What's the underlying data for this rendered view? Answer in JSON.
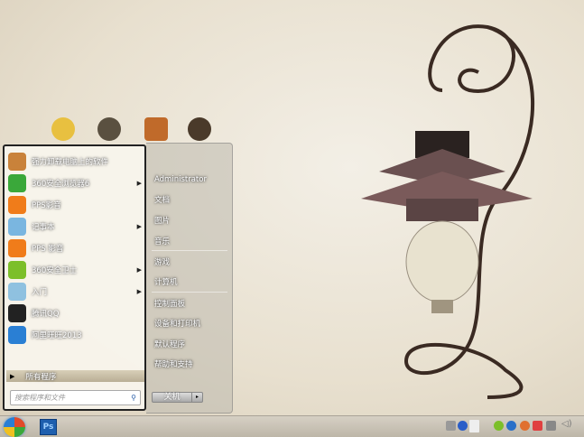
{
  "start_menu": {
    "programs": [
      {
        "label": "强力卸载电脑上的软件",
        "icon": "uninstall-icon",
        "color": "#c9823a",
        "submenu": false
      },
      {
        "label": "360安全浏览器6",
        "icon": "360-browser-icon",
        "color": "#3aa83a",
        "submenu": true
      },
      {
        "label": "PPS影音",
        "icon": "pps-icon",
        "color": "#f07c1a",
        "submenu": false
      },
      {
        "label": "记事本",
        "icon": "notepad-icon",
        "color": "#7ab6e0",
        "submenu": true
      },
      {
        "label": "PPS 影音",
        "icon": "pps-icon",
        "color": "#f07c1a",
        "submenu": false
      },
      {
        "label": "360安全卫士",
        "icon": "360-safe-icon",
        "color": "#7cbf2a",
        "submenu": true
      },
      {
        "label": "入门",
        "icon": "getting-started-icon",
        "color": "#8fc1e0",
        "submenu": true
      },
      {
        "label": "腾讯QQ",
        "icon": "qq-penguin-icon",
        "color": "#222",
        "submenu": false
      },
      {
        "label": "阿里旺旺2013",
        "icon": "aliwangwang-icon",
        "color": "#2a7fd4",
        "submenu": false
      }
    ],
    "all_programs": "所有程序",
    "search_placeholder": "搜索程序和文件",
    "right": [
      "Administrator",
      "文档",
      "图片",
      "音乐",
      "游戏",
      "计算机",
      "控制面板",
      "设备和打印机",
      "默认程序",
      "帮助和支持"
    ],
    "shutdown": "关机"
  },
  "taskbar": {
    "ps_label": "Ps"
  }
}
